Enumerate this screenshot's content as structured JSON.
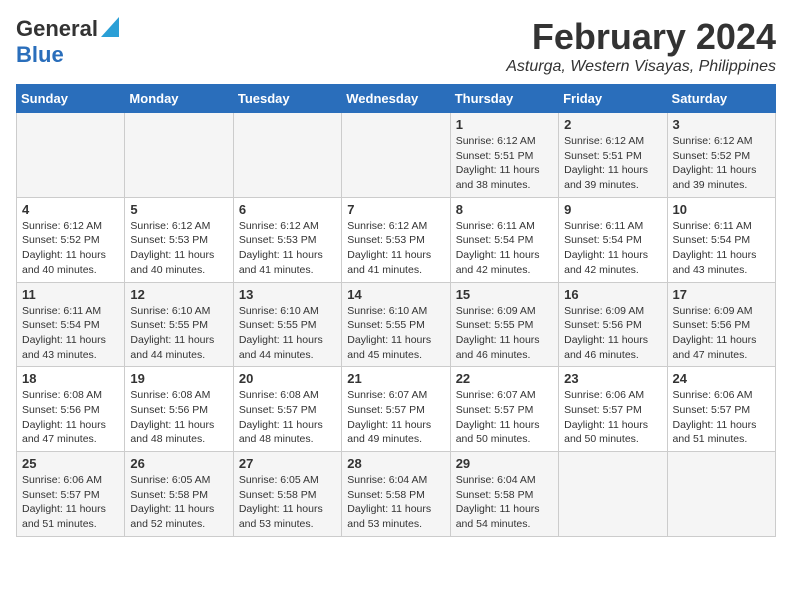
{
  "logo": {
    "line1": "General",
    "line2": "Blue"
  },
  "title": {
    "month_year": "February 2024",
    "location": "Asturga, Western Visayas, Philippines"
  },
  "days_of_week": [
    "Sunday",
    "Monday",
    "Tuesday",
    "Wednesday",
    "Thursday",
    "Friday",
    "Saturday"
  ],
  "weeks": [
    [
      {
        "day": "",
        "info": ""
      },
      {
        "day": "",
        "info": ""
      },
      {
        "day": "",
        "info": ""
      },
      {
        "day": "",
        "info": ""
      },
      {
        "day": "1",
        "info": "Sunrise: 6:12 AM\nSunset: 5:51 PM\nDaylight: 11 hours and 38 minutes."
      },
      {
        "day": "2",
        "info": "Sunrise: 6:12 AM\nSunset: 5:51 PM\nDaylight: 11 hours and 39 minutes."
      },
      {
        "day": "3",
        "info": "Sunrise: 6:12 AM\nSunset: 5:52 PM\nDaylight: 11 hours and 39 minutes."
      }
    ],
    [
      {
        "day": "4",
        "info": "Sunrise: 6:12 AM\nSunset: 5:52 PM\nDaylight: 11 hours and 40 minutes."
      },
      {
        "day": "5",
        "info": "Sunrise: 6:12 AM\nSunset: 5:53 PM\nDaylight: 11 hours and 40 minutes."
      },
      {
        "day": "6",
        "info": "Sunrise: 6:12 AM\nSunset: 5:53 PM\nDaylight: 11 hours and 41 minutes."
      },
      {
        "day": "7",
        "info": "Sunrise: 6:12 AM\nSunset: 5:53 PM\nDaylight: 11 hours and 41 minutes."
      },
      {
        "day": "8",
        "info": "Sunrise: 6:11 AM\nSunset: 5:54 PM\nDaylight: 11 hours and 42 minutes."
      },
      {
        "day": "9",
        "info": "Sunrise: 6:11 AM\nSunset: 5:54 PM\nDaylight: 11 hours and 42 minutes."
      },
      {
        "day": "10",
        "info": "Sunrise: 6:11 AM\nSunset: 5:54 PM\nDaylight: 11 hours and 43 minutes."
      }
    ],
    [
      {
        "day": "11",
        "info": "Sunrise: 6:11 AM\nSunset: 5:54 PM\nDaylight: 11 hours and 43 minutes."
      },
      {
        "day": "12",
        "info": "Sunrise: 6:10 AM\nSunset: 5:55 PM\nDaylight: 11 hours and 44 minutes."
      },
      {
        "day": "13",
        "info": "Sunrise: 6:10 AM\nSunset: 5:55 PM\nDaylight: 11 hours and 44 minutes."
      },
      {
        "day": "14",
        "info": "Sunrise: 6:10 AM\nSunset: 5:55 PM\nDaylight: 11 hours and 45 minutes."
      },
      {
        "day": "15",
        "info": "Sunrise: 6:09 AM\nSunset: 5:55 PM\nDaylight: 11 hours and 46 minutes."
      },
      {
        "day": "16",
        "info": "Sunrise: 6:09 AM\nSunset: 5:56 PM\nDaylight: 11 hours and 46 minutes."
      },
      {
        "day": "17",
        "info": "Sunrise: 6:09 AM\nSunset: 5:56 PM\nDaylight: 11 hours and 47 minutes."
      }
    ],
    [
      {
        "day": "18",
        "info": "Sunrise: 6:08 AM\nSunset: 5:56 PM\nDaylight: 11 hours and 47 minutes."
      },
      {
        "day": "19",
        "info": "Sunrise: 6:08 AM\nSunset: 5:56 PM\nDaylight: 11 hours and 48 minutes."
      },
      {
        "day": "20",
        "info": "Sunrise: 6:08 AM\nSunset: 5:57 PM\nDaylight: 11 hours and 48 minutes."
      },
      {
        "day": "21",
        "info": "Sunrise: 6:07 AM\nSunset: 5:57 PM\nDaylight: 11 hours and 49 minutes."
      },
      {
        "day": "22",
        "info": "Sunrise: 6:07 AM\nSunset: 5:57 PM\nDaylight: 11 hours and 50 minutes."
      },
      {
        "day": "23",
        "info": "Sunrise: 6:06 AM\nSunset: 5:57 PM\nDaylight: 11 hours and 50 minutes."
      },
      {
        "day": "24",
        "info": "Sunrise: 6:06 AM\nSunset: 5:57 PM\nDaylight: 11 hours and 51 minutes."
      }
    ],
    [
      {
        "day": "25",
        "info": "Sunrise: 6:06 AM\nSunset: 5:57 PM\nDaylight: 11 hours and 51 minutes."
      },
      {
        "day": "26",
        "info": "Sunrise: 6:05 AM\nSunset: 5:58 PM\nDaylight: 11 hours and 52 minutes."
      },
      {
        "day": "27",
        "info": "Sunrise: 6:05 AM\nSunset: 5:58 PM\nDaylight: 11 hours and 53 minutes."
      },
      {
        "day": "28",
        "info": "Sunrise: 6:04 AM\nSunset: 5:58 PM\nDaylight: 11 hours and 53 minutes."
      },
      {
        "day": "29",
        "info": "Sunrise: 6:04 AM\nSunset: 5:58 PM\nDaylight: 11 hours and 54 minutes."
      },
      {
        "day": "",
        "info": ""
      },
      {
        "day": "",
        "info": ""
      }
    ]
  ]
}
